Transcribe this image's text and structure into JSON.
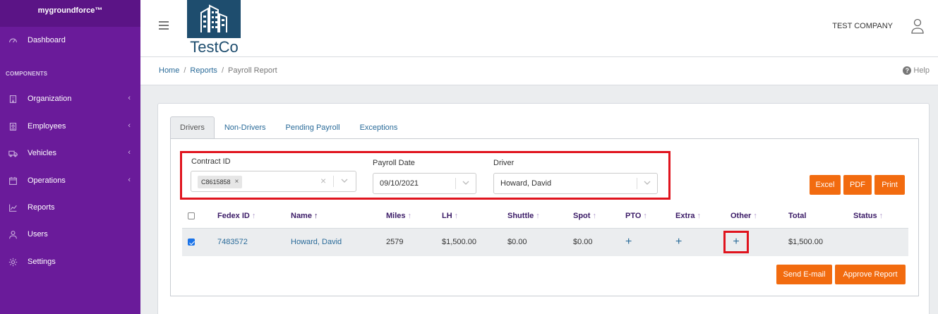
{
  "sidebar": {
    "brand": "mygroundforce™",
    "section_title": "COMPONENTS",
    "items": [
      {
        "label": "Dashboard",
        "icon": "speedometer-icon"
      },
      {
        "label": "Organization",
        "icon": "building-icon"
      },
      {
        "label": "Employees",
        "icon": "id-badge-icon"
      },
      {
        "label": "Vehicles",
        "icon": "truck-icon"
      },
      {
        "label": "Operations",
        "icon": "calendar-icon"
      },
      {
        "label": "Reports",
        "icon": "chart-line-icon"
      },
      {
        "label": "Users",
        "icon": "user-icon"
      },
      {
        "label": "Settings",
        "icon": "gear-icon"
      }
    ],
    "chevron": "‹"
  },
  "header": {
    "logo_text": "TestCo",
    "company": "TEST COMPANY"
  },
  "breadcrumb": {
    "home": "Home",
    "reports": "Reports",
    "current": "Payroll Report",
    "sep": "/",
    "help": "Help"
  },
  "tabs": [
    "Drivers",
    "Non-Drivers",
    "Pending Payroll",
    "Exceptions"
  ],
  "filters": {
    "contract_label": "Contract ID",
    "contract_chip": "C8615858",
    "payroll_label": "Payroll Date",
    "payroll_value": "09/10/2021",
    "driver_label": "Driver",
    "driver_value": "Howard, David"
  },
  "buttons": {
    "excel": "Excel",
    "pdf": "PDF",
    "print": "Print",
    "send_email": "Send E-mail",
    "approve": "Approve Report"
  },
  "table": {
    "headers": [
      "Fedex ID",
      "Name",
      "Miles",
      "LH",
      "Shuttle",
      "Spot",
      "PTO",
      "Extra",
      "Other",
      "Total",
      "Status"
    ],
    "sort_arrow": "↑",
    "row": {
      "fedex_id": "7483572",
      "name": "Howard, David",
      "miles": "2579",
      "lh": "$1,500.00",
      "shuttle": "$0.00",
      "spot": "$0.00",
      "plus": "+",
      "total": "$1,500.00"
    }
  },
  "colors": {
    "sidebar": "#6a1b9a",
    "accent_button": "#f26b0f",
    "highlight": "#e0141e"
  }
}
